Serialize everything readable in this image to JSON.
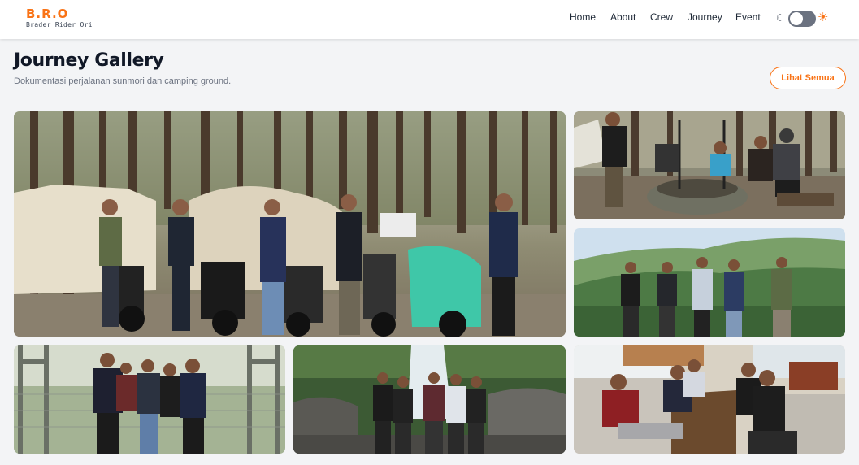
{
  "brand": {
    "title": "B.R.O",
    "subtitle": "Brader Rider Ori"
  },
  "nav": {
    "items": [
      "Home",
      "About",
      "Crew",
      "Journey",
      "Event"
    ]
  },
  "theme_toggle": {
    "dark_icon": "moon-icon",
    "light_icon": "sun-icon",
    "state": "light"
  },
  "header": {
    "title": "Journey Gallery",
    "subtitle": "Dokumentasi perjalanan sunmori dan camping ground.",
    "see_all_label": "Lihat Semua"
  },
  "colors": {
    "accent": "#f97316",
    "text": "#111827",
    "muted": "#6b7280",
    "background": "#f3f4f6"
  }
}
